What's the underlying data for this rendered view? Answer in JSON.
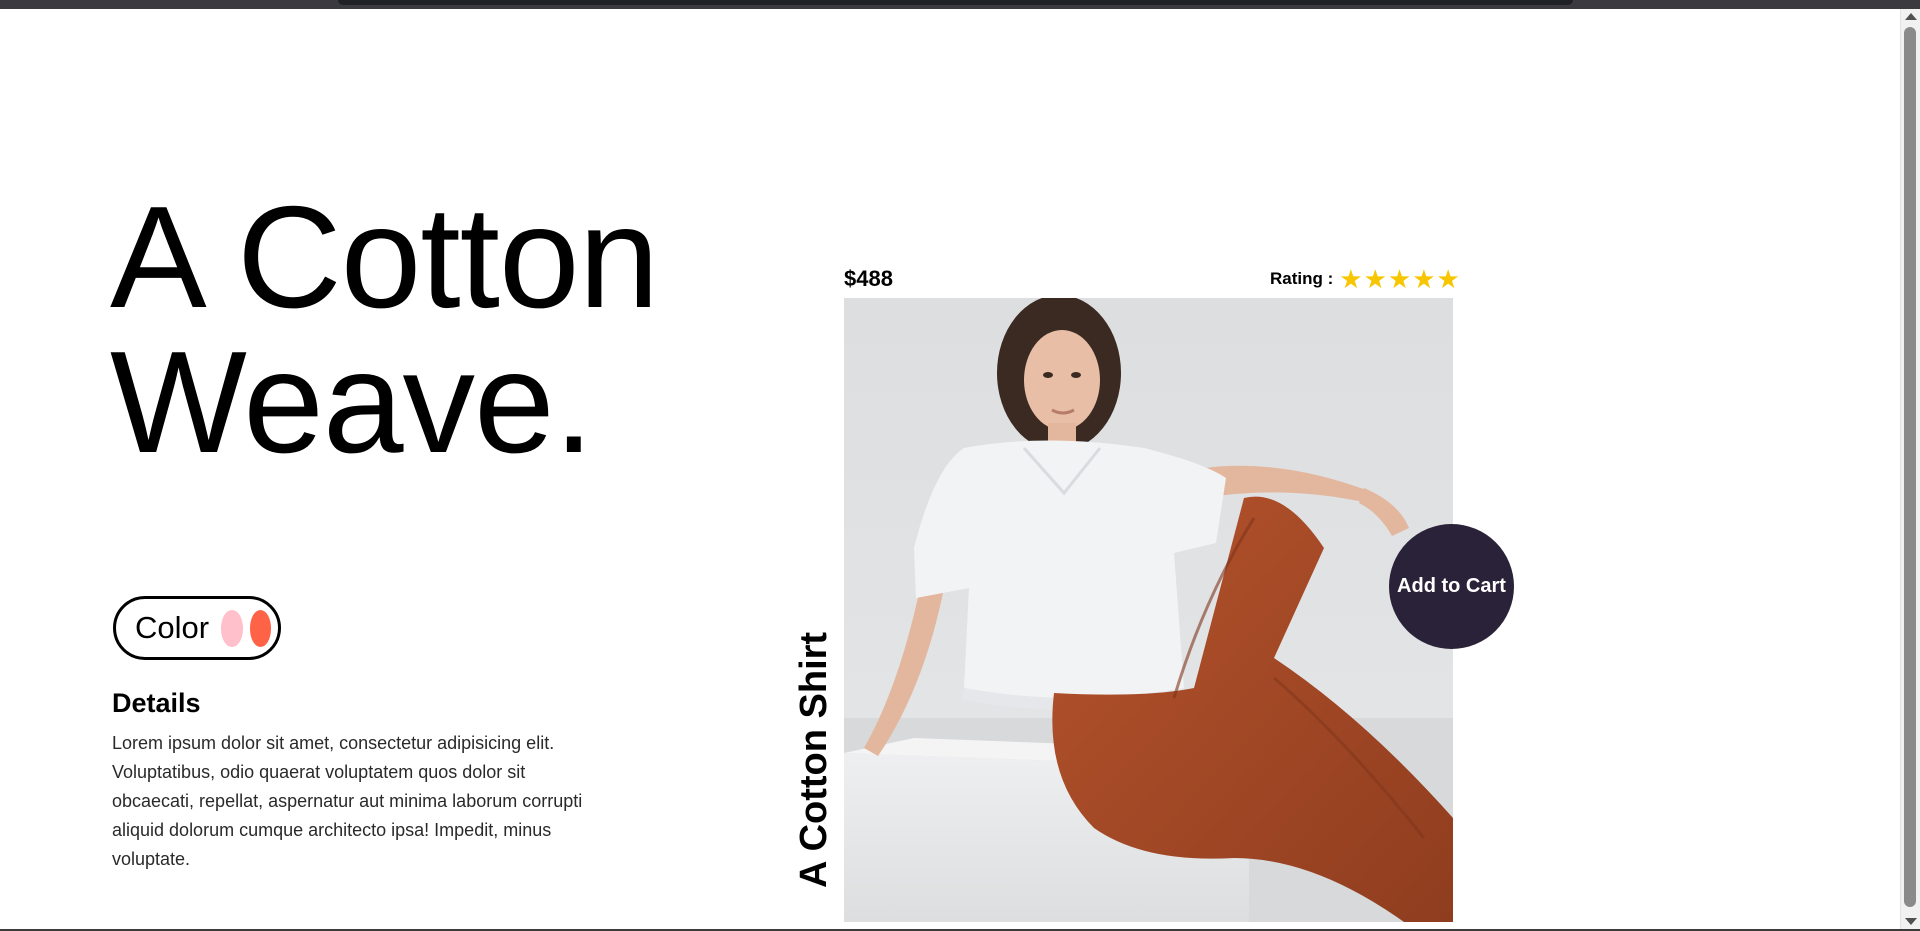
{
  "hero": {
    "title_line_1": "A Cotton",
    "title_line_2": "Weave."
  },
  "color_selector": {
    "label": "Color",
    "swatches": [
      {
        "name": "pink",
        "color": "#ffc0cb"
      },
      {
        "name": "tomato",
        "color": "#ff6347"
      }
    ]
  },
  "details": {
    "title": "Details",
    "text": "Lorem ipsum dolor sit amet, consectetur adipisicing elit. Voluptatibus, odio quaerat voluptatem quos dolor sit obcaecati, repellat, aspernatur aut minima laborum corrupti aliquid dolorum cumque architecto ipsa! Impedit, minus voluptate."
  },
  "product": {
    "price": "$488",
    "rating_label": "Rating :",
    "rating_stars": 5,
    "star_color": "#f7c600",
    "vertical_title": "A Cotton Shirt",
    "add_to_cart_label": "Add to Cart",
    "add_to_cart_color": "#2a2238"
  },
  "icons": {
    "star": "star-icon"
  }
}
